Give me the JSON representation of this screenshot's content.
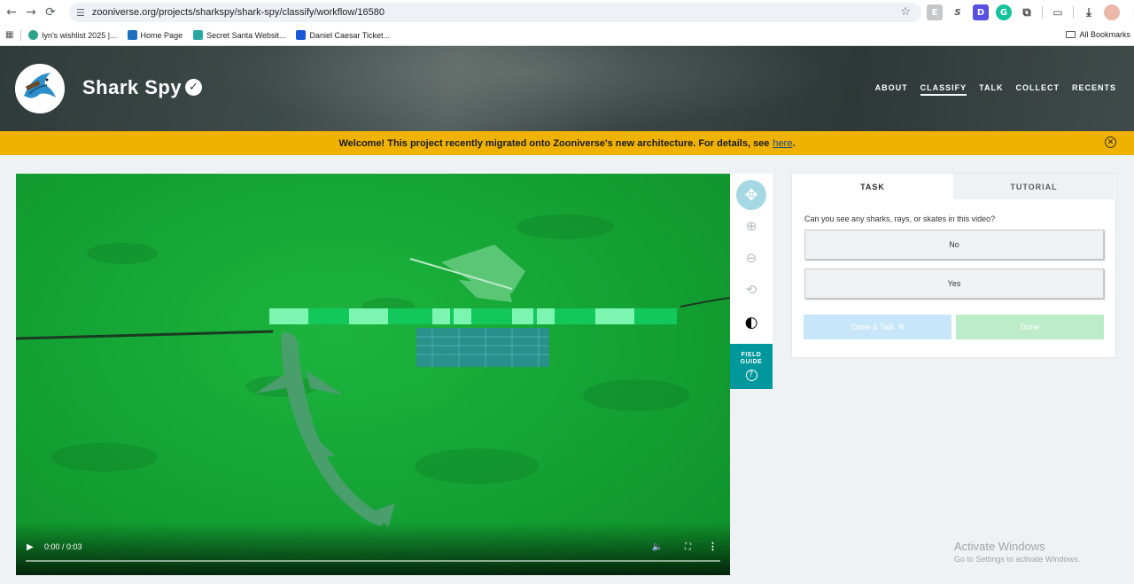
{
  "browser": {
    "url": "zooniverse.org/projects/sharkspy/shark-spy/classify/workflow/16580",
    "bookmarks": [
      {
        "label": "lyn's wishlist 2025 |...",
        "icon": "giftbox-icon",
        "color": "#2fa38a"
      },
      {
        "label": "Home Page",
        "icon": "home-icon",
        "color": "#1f6fbf"
      },
      {
        "label": "Secret Santa Websit...",
        "icon": "gift-icon",
        "color": "#2aa7a0"
      },
      {
        "label": "Daniel Caesar Ticket...",
        "icon": "ticket-icon",
        "color": "#1a56d6"
      }
    ],
    "all_bookmarks": "All Bookmarks"
  },
  "project": {
    "title": "Shark Spy",
    "nav": [
      "ABOUT",
      "CLASSIFY",
      "TALK",
      "COLLECT",
      "RECENTS"
    ],
    "active_nav": "CLASSIFY"
  },
  "banner": {
    "text": "Welcome! This project recently migrated onto Zooniverse's new architecture. For details, see",
    "link": "here",
    "end": "."
  },
  "video": {
    "time": "0:00 / 0:03",
    "progress": 0
  },
  "toolbar": {
    "tools": [
      "move-icon",
      "zoom-in-icon",
      "zoom-out-icon",
      "rotate-icon",
      "contrast-icon"
    ],
    "field_guide_line1": "FIELD",
    "field_guide_line2": "GUIDE"
  },
  "task": {
    "tabs": [
      "TASK",
      "TUTORIAL"
    ],
    "question": "Can you see any sharks, rays, or skates in this video?",
    "answers": [
      "No",
      "Yes"
    ],
    "done_talk": "Done & Talk",
    "done": "Done"
  },
  "watermark": {
    "title": "Activate Windows",
    "subtitle": "Go to Settings to activate Windows."
  },
  "colors": {
    "banner": "#f0b200",
    "field_guide": "#00979d",
    "video_green": "#15a535"
  }
}
